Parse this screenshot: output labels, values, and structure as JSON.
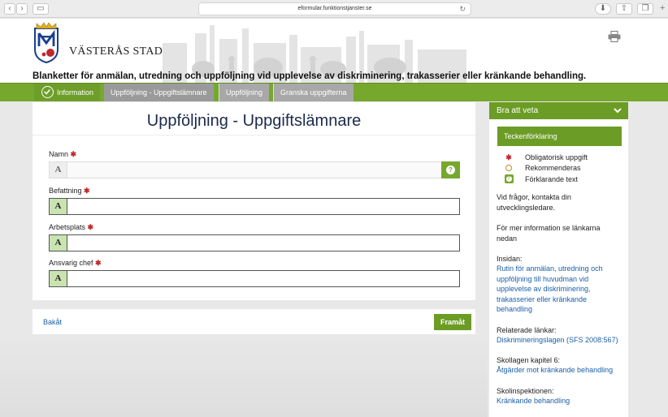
{
  "browser": {
    "url": "eformular.funktionstjanster.se"
  },
  "header": {
    "logo_text": "VÄSTERÅS STAD",
    "heading": "Blanketter för anmälan, utredning och uppföljning vid upplevelse av diskriminering, trakasserier eller kränkande behandling."
  },
  "nav": {
    "tabs": [
      {
        "label": "Information"
      },
      {
        "label": "Uppföljning - Uppgiftslämnare"
      },
      {
        "label": "Uppföljning"
      },
      {
        "label": "Granska uppgifterna"
      }
    ]
  },
  "form": {
    "title": "Uppföljning - Uppgiftslämnare",
    "fields": [
      {
        "label": "Namn",
        "value": ""
      },
      {
        "label": "Befattning",
        "value": ""
      },
      {
        "label": "Arbetsplats",
        "value": ""
      },
      {
        "label": "Ansvarig chef",
        "value": ""
      }
    ],
    "required_mark": "✱",
    "input_icon": "A",
    "help_icon": "?",
    "back": "Bakåt",
    "next": "Framåt"
  },
  "sidebar": {
    "title": "Bra att veta",
    "legend_title": "Teckenförklaring",
    "legend": [
      {
        "icon": "required-star-icon",
        "label": "Obligatorisk uppgift"
      },
      {
        "icon": "recommended-ring-icon",
        "label": "Rekommenderas"
      },
      {
        "icon": "help-icon",
        "label": "Förklarande text"
      }
    ],
    "contact": "Vid frågor, kontakta din utvecklingsledare.",
    "more_info": "För mer information se länkarna nedan",
    "insidan_label": "Insidan:",
    "insidan_link": "Rutin för anmälan, utredning och uppföljning till huvudman vid upplevelse av diskriminering, trakasserier eller kränkande behandling",
    "related_label": "Relaterade länkar:",
    "related_link": "Diskrimineringslagen (SFS 2008:567)",
    "school_label": "Skollagen kapitel 6:",
    "school_link": "Åtgärder mot kränkande behandling",
    "inspect_label": "Skolinspektionen:",
    "inspect_link": "Kränkande behandling"
  },
  "colors": {
    "brand_green": "#76a82e",
    "required_red": "#c0282d",
    "link_blue": "#1a5fa8"
  }
}
